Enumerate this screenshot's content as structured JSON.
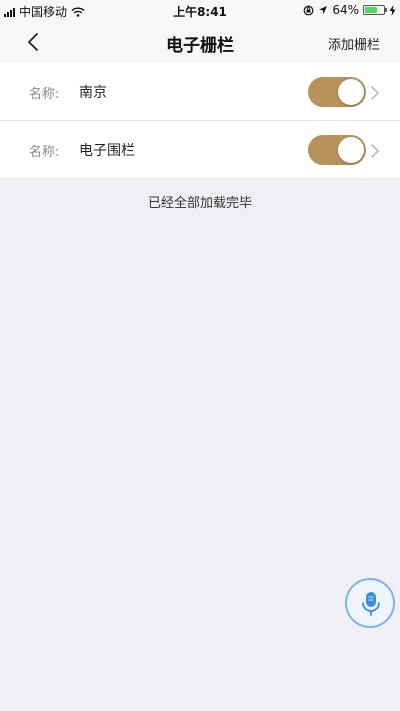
{
  "status_bar": {
    "carrier": "中国移动",
    "time": "上午8:41",
    "battery_percent": "64%",
    "battery_level": 0.64,
    "battery_color": "#4cd964"
  },
  "nav": {
    "back_icon": "chevron-left-icon",
    "title": "电子栅栏",
    "action_label": "添加栅栏"
  },
  "fences": [
    {
      "label": "名称:",
      "value": "南京",
      "enabled": true
    },
    {
      "label": "名称:",
      "value": "电子围栏",
      "enabled": true
    }
  ],
  "list_footer": "已经全部加载完毕",
  "colors": {
    "toggle_on": "#b8925c",
    "voice_accent": "#7db2ea"
  },
  "voice_button": {
    "icon": "microphone-icon"
  }
}
